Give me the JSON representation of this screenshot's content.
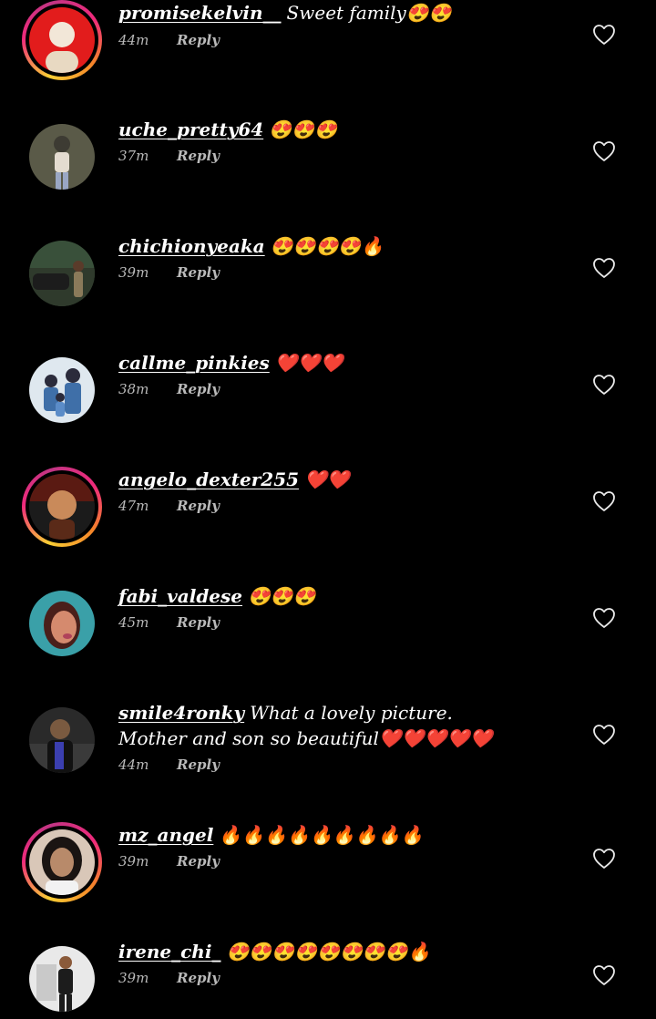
{
  "comments": [
    {
      "username": "promisekelvin__",
      "text": "Sweet family😍😍",
      "time": "44m",
      "reply_label": "Reply",
      "story_ring": true,
      "avatar_colors": [
        "#e21c1c",
        "#f2e7d8",
        "#e8d9c2"
      ]
    },
    {
      "username": "uche_pretty64",
      "text": "😍😍😍",
      "time": "37m",
      "reply_label": "Reply",
      "story_ring": false,
      "avatar_colors": [
        "#5a5a48",
        "#e4dcd0",
        "#3d3b33"
      ]
    },
    {
      "username": "chichionyeaka",
      "text": "😍😍😍😍🔥",
      "time": "39m",
      "reply_label": "Reply",
      "story_ring": false,
      "avatar_colors": [
        "#39503a",
        "#1c1c1c",
        "#8a7a5a"
      ]
    },
    {
      "username": "callme_pinkies",
      "text": "❤️❤️❤️",
      "time": "38m",
      "reply_label": "Reply",
      "story_ring": false,
      "avatar_colors": [
        "#dfe8ef",
        "#3f6fa8",
        "#2b2b3b"
      ]
    },
    {
      "username": "angelo_dexter255",
      "text": "❤️❤️",
      "time": "47m",
      "reply_label": "Reply",
      "story_ring": true,
      "avatar_colors": [
        "#5a1a12",
        "#1b1b1b",
        "#c98a5a"
      ]
    },
    {
      "username": "fabi_valdese",
      "text": "😍😍😍",
      "time": "45m",
      "reply_label": "Reply",
      "story_ring": false,
      "avatar_colors": [
        "#3aa0a8",
        "#d58a6e",
        "#4a1f1a"
      ]
    },
    {
      "username": "smile4ronky",
      "text": "What a lovely picture.  Mother and son so beautiful❤️❤️❤️❤️❤️",
      "time": "44m",
      "reply_label": "Reply",
      "story_ring": false,
      "avatar_colors": [
        "#2a2a2a",
        "#3b3fb0",
        "#7a5a40"
      ]
    },
    {
      "username": "mz_angel",
      "text": "🔥🔥🔥🔥🔥🔥🔥🔥🔥",
      "time": "39m",
      "reply_label": "Reply",
      "story_ring": true,
      "avatar_colors": [
        "#d9c7b8",
        "#1a1412",
        "#b88a6a"
      ]
    },
    {
      "username": "irene_chi_",
      "text": "😍😍😍😍😍😍😍😍🔥",
      "time": "39m",
      "reply_label": "Reply",
      "story_ring": false,
      "avatar_colors": [
        "#e9e9e9",
        "#1c1c1c",
        "#8a5a3a"
      ]
    }
  ],
  "like_icon": "heart-outline-icon",
  "colors": {
    "background": "#000000",
    "text": "#ffffff",
    "meta": "#b9b9b9"
  }
}
